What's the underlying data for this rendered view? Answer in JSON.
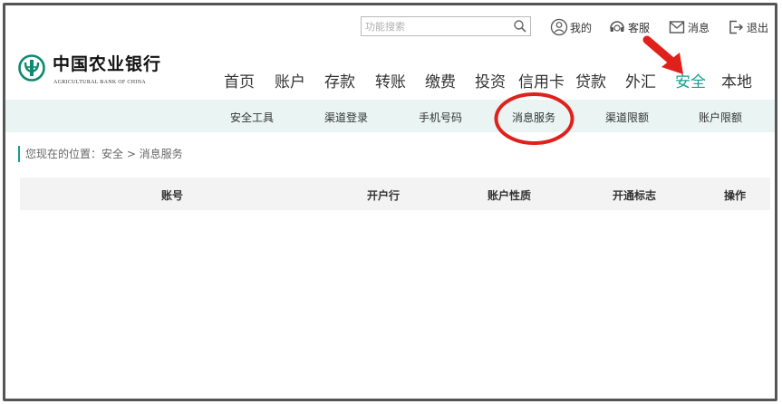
{
  "search": {
    "placeholder": "功能搜索"
  },
  "topbar": {
    "mine_label": "我的",
    "service_label": "客服",
    "messages_label": "消息",
    "logout_label": "退出"
  },
  "logo": {
    "name_cn": "中国农业银行",
    "name_en": "AGRICULTURAL BANK OF CHINA"
  },
  "main_nav": {
    "items": [
      "首页",
      "账户",
      "存款",
      "转账",
      "缴费",
      "投资",
      "信用卡",
      "贷款",
      "外汇",
      "安全",
      "本地"
    ],
    "active": "安全"
  },
  "sub_nav": {
    "items": [
      "安全工具",
      "渠道登录",
      "手机号码",
      "消息服务",
      "渠道限额",
      "账户限额"
    ],
    "highlighted": "消息服务"
  },
  "breadcrumb": {
    "text": "您现在的位置：安全 > 消息服务"
  },
  "table": {
    "headers": [
      "账号",
      "开户行",
      "账户性质",
      "开通标志",
      "操作"
    ]
  },
  "colors": {
    "accent": "#14a08f",
    "annotation_red": "#e0211b",
    "subnav_bg": "#e9f4f3",
    "table_header_bg": "#f3f3f3"
  },
  "icons": {
    "search": "search-icon",
    "mine": "user-icon",
    "service": "headset-icon",
    "messages": "envelope-icon",
    "logout": "logout-icon",
    "logo": "abc-emblem-icon"
  }
}
